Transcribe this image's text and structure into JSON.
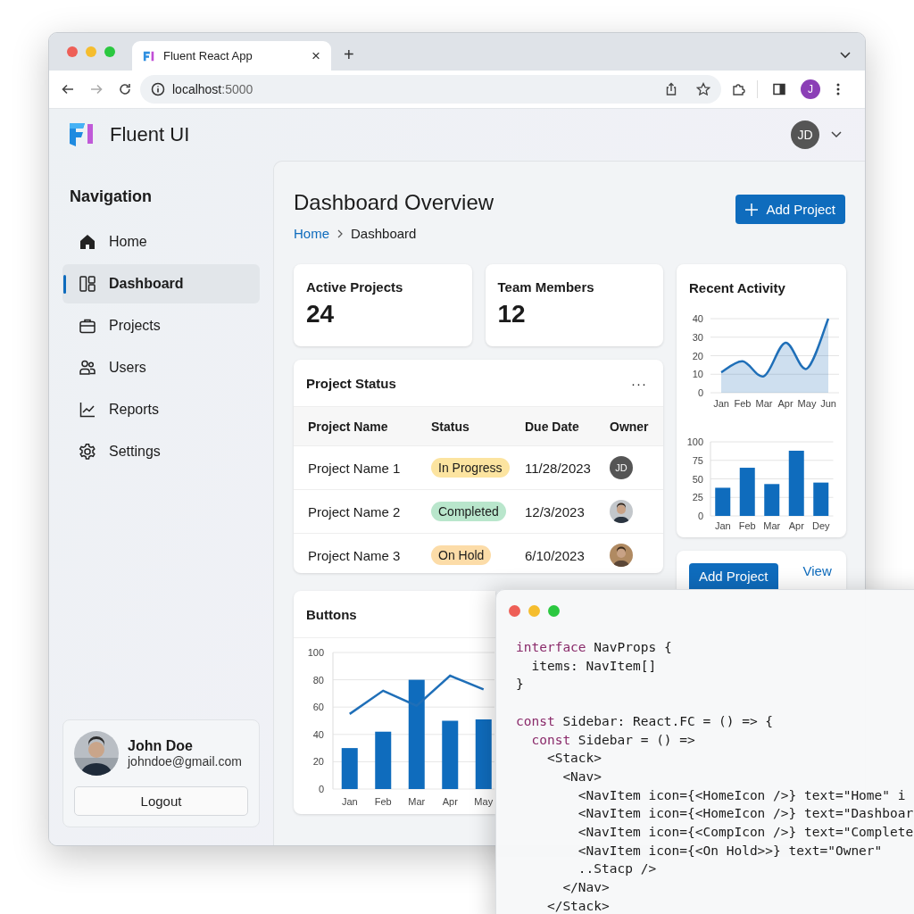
{
  "browser": {
    "tab_title": "Fluent React App",
    "tab_close": "×",
    "new_tab": "+",
    "url_host": "localhost",
    "url_port": ":5000",
    "profile_initial": "J"
  },
  "app_header": {
    "brand": "Fluent UI",
    "user_initials": "JD"
  },
  "sidebar": {
    "heading": "Navigation",
    "items": [
      {
        "label": "Home",
        "kind": "home",
        "selected": false
      },
      {
        "label": "Dashboard",
        "kind": "dashboard",
        "selected": true
      },
      {
        "label": "Projects",
        "kind": "briefcase",
        "selected": false
      },
      {
        "label": "Users",
        "kind": "people",
        "selected": false
      },
      {
        "label": "Reports",
        "kind": "chart",
        "selected": false
      },
      {
        "label": "Settings",
        "kind": "gear",
        "selected": false
      }
    ],
    "user": {
      "name": "John Doe",
      "email": "johndoe@gmail.com",
      "logout": "Logout"
    }
  },
  "page_header": {
    "title": "Dashboard Overview",
    "breadcrumb": [
      "Home",
      "Dashboard"
    ],
    "add_button": "Add Project"
  },
  "stats": [
    {
      "label": "Active Projects",
      "value": "24"
    },
    {
      "label": "Team Members",
      "value": "12"
    }
  ],
  "recent_activity": {
    "title": "Recent Activity",
    "area_chart": {
      "chart_data": {
        "type": "area",
        "categories": [
          "Jan",
          "Feb",
          "Mar",
          "Apr",
          "May",
          "Jun"
        ],
        "series": [
          {
            "color": "#1f6fb8",
            "values": [
              11,
              17,
              9,
              27,
              13,
              40
            ]
          }
        ],
        "ylim": [
          0,
          40
        ],
        "yticks": [
          0,
          10,
          20,
          30,
          40
        ],
        "grid": true
      }
    },
    "bar_chart": {
      "chart_data": {
        "type": "bar",
        "categories": [
          "Jan",
          "Feb",
          "Mar",
          "Apr",
          "Dey"
        ],
        "series": [
          {
            "color": "#0f6cbd",
            "values": [
              38,
              65,
              43,
              88,
              45
            ]
          }
        ],
        "ylim": [
          0,
          100
        ],
        "yticks": [
          0,
          25,
          50,
          75,
          100
        ],
        "grid": true
      }
    }
  },
  "project_status": {
    "title": "Project Status",
    "more": "···",
    "columns": [
      "Project Name",
      "Status",
      "Due Date",
      "Owner"
    ],
    "rows": [
      {
        "name": "Project Name 1",
        "status": "In Progress",
        "color": "#fce4a0",
        "due": "11/28/2023",
        "owner": {
          "kind": "initials",
          "initials": "JD"
        }
      },
      {
        "name": "Project Name 2",
        "status": "Completed",
        "color": "#b9e6cc",
        "due": "12/3/2023"
      },
      {
        "name": "Project Name 3",
        "status": "On Hold",
        "color": "#fcdca8",
        "due": "6/10/2023"
      }
    ]
  },
  "actions_card": {
    "add_button": "Add Project",
    "view_link": "View"
  },
  "buttons_card": {
    "title": "Buttons",
    "chart_data": {
      "type": "bar",
      "categories": [
        "Jan",
        "Feb",
        "Mar",
        "Apr",
        "May"
      ],
      "series": [
        {
          "color": "#0f6cbd",
          "values": [
            30,
            42,
            80,
            50,
            51
          ]
        },
        {
          "type": "line",
          "color": "#1f6fb8",
          "values": [
            55,
            72,
            61,
            83,
            73
          ]
        }
      ],
      "ylim": [
        0,
        100
      ],
      "yticks": [
        0,
        20,
        40,
        60,
        80,
        100
      ],
      "grid": true
    }
  },
  "code_window": {
    "blocks": [
      [
        [
          {
            "t": "interface",
            "kind": "keyword"
          },
          {
            "t": " NavProps {",
            "kind": "plain"
          }
        ],
        [
          {
            "t": "  items: NavItem[]",
            "kind": "plain"
          }
        ],
        [
          {
            "t": "}",
            "kind": "plain"
          }
        ]
      ],
      [
        [
          {
            "t": "const",
            "kind": "keyword"
          },
          {
            "t": " Sidebar: React.FC = () => {",
            "kind": "plain"
          }
        ],
        [
          {
            "t": "  const",
            "kind": "keyword"
          },
          {
            "t": " Sidebar = () =>",
            "kind": "plain"
          }
        ],
        [
          {
            "t": "    <Stack>",
            "kind": "plain"
          }
        ],
        [
          {
            "t": "      <Nav>",
            "kind": "plain"
          }
        ],
        [
          {
            "t": "        <NavItem icon={<HomeIcon />} text=\"Home\" i",
            "kind": "plain"
          }
        ],
        [
          {
            "t": "        <NavItem icon={<HomeIcon />} text=\"Dashboar",
            "kind": "plain"
          }
        ],
        [
          {
            "t": "        <NavItem icon={<CompIcon />} text=\"Complete",
            "kind": "plain"
          }
        ],
        [
          {
            "t": "        <NavItem icon={<On Hold>>} text=\"Owner\"",
            "kind": "plain"
          }
        ],
        [
          {
            "t": "        ..Stacp />",
            "kind": "plain"
          }
        ],
        [
          {
            "t": "      </Nav>",
            "kind": "plain"
          }
        ],
        [
          {
            "t": "    </Stack>",
            "kind": "plain"
          }
        ]
      ]
    ]
  }
}
